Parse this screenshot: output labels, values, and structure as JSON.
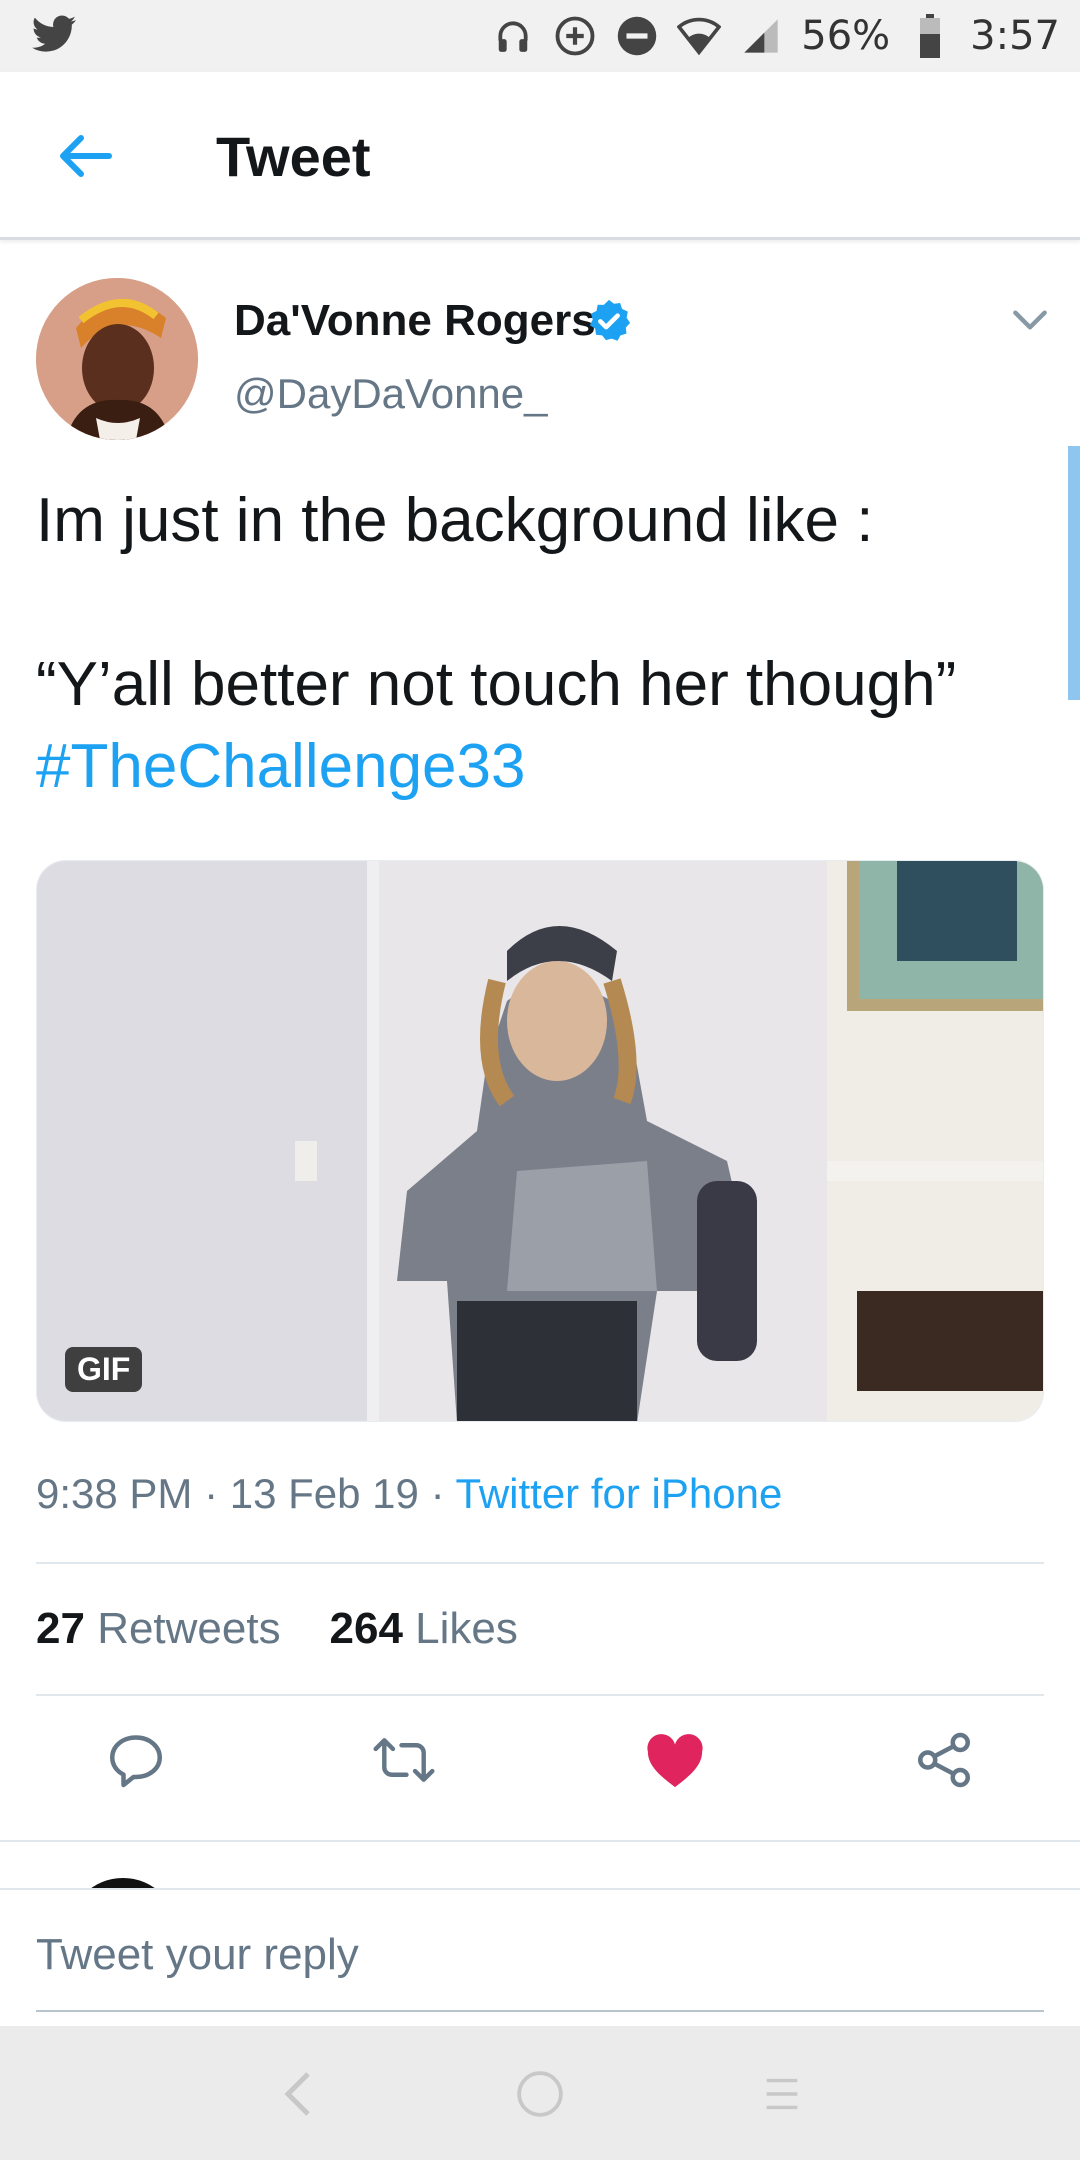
{
  "status_bar": {
    "battery": "56%",
    "time": "3:57",
    "icons": [
      "twitter-bird-icon",
      "headphones-icon",
      "data-saver-icon",
      "do-not-disturb-icon",
      "wifi-icon",
      "signal-icon",
      "battery-icon"
    ]
  },
  "header": {
    "title": "Tweet"
  },
  "tweet": {
    "author_name": "Da'Vonne Rogers",
    "handle": "@DayDaVonne_",
    "text_lines": [
      "Im just in the background like :",
      "",
      "“Y’all better not touch her though”"
    ],
    "hashtag": "#TheChallenge33",
    "media_badge": "GIF",
    "time": "9:38 PM",
    "date": "13 Feb 19",
    "source": "Twitter for iPhone",
    "retweets_count": "27",
    "retweets_label": "Retweets",
    "likes_count": "264",
    "likes_label": "Likes"
  },
  "reply": {
    "placeholder": "Tweet your reply"
  },
  "colors": {
    "accent": "#1da1f2",
    "like": "#e0245e",
    "text": "#14171a",
    "secondary": "#657786"
  }
}
